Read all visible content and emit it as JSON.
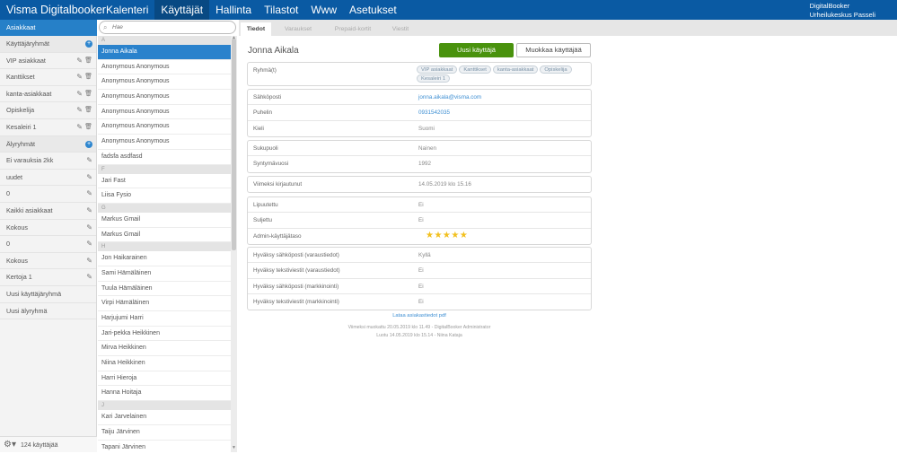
{
  "topbar": {
    "brand": "Visma Digitalbooker",
    "nav": [
      "Kalenteri",
      "Käyttäjät",
      "Hallinta",
      "Tilastot",
      "Www",
      "Asetukset"
    ],
    "account_line1": "DigitalBooker",
    "account_line2": "Urheilukeskus Passeli"
  },
  "sidebar": {
    "section_tab": "Asiakkaat",
    "rows": [
      {
        "label": "Käyttäjäryhmät",
        "type": "header"
      },
      {
        "label": "VIP asiakkaat",
        "type": "group"
      },
      {
        "label": "Kanttikset",
        "type": "group"
      },
      {
        "label": "kanta-asiakkaat",
        "type": "group"
      },
      {
        "label": "Opiskelija",
        "type": "group"
      },
      {
        "label": "Kesaleiri 1",
        "type": "group"
      },
      {
        "label": "Älyryhmät",
        "type": "header"
      },
      {
        "label": "Ei varauksia 2kk",
        "type": "smart"
      },
      {
        "label": "uudet",
        "type": "smart"
      },
      {
        "label": "0",
        "type": "smart"
      },
      {
        "label": "Kaikki asiakkaat",
        "type": "smart"
      },
      {
        "label": "Kokous",
        "type": "smart"
      },
      {
        "label": "0",
        "type": "smart"
      },
      {
        "label": "Kokous",
        "type": "smart"
      },
      {
        "label": "Kertoja 1",
        "type": "smart"
      },
      {
        "label": "Uusi käyttäjäryhmä",
        "type": "action"
      },
      {
        "label": "Uusi älyryhmä",
        "type": "action"
      }
    ],
    "footer_count": "124 käyttäjää"
  },
  "search": {
    "placeholder": "Hae"
  },
  "user_list": [
    {
      "group": "A",
      "users": [
        "Jonna Aikala",
        "Anonymous Anonymous",
        "Anonymous Anonymous",
        "Anonymous Anonymous",
        "Anonymous Anonymous",
        "Anonymous Anonymous",
        "Anonymous Anonymous",
        "fadsfa asdfasd"
      ]
    },
    {
      "group": "F",
      "users": [
        "Jari Fast",
        "Liisa Fysio"
      ]
    },
    {
      "group": "G",
      "users": [
        "Markus Gmail",
        "Markus Gmail"
      ]
    },
    {
      "group": "H",
      "users": [
        "Jon Haikarainen",
        "Sami Hämäläinen",
        "Tuula Hämäläinen",
        "Virpi Hämäläinen",
        "Harjujumi Harri",
        "Jari-pekka Heikkinen",
        "Mirva Heikkinen",
        "Niina Heikkinen",
        "Harri Hieroja",
        "Hanna Hoitaja"
      ]
    },
    {
      "group": "J",
      "users": [
        "Kari Jarvelainen",
        "Taiju Järvinen",
        "Tapani Järvinen"
      ]
    }
  ],
  "selected_user": "Jonna Aikala",
  "tabs": [
    "Tiedot",
    "Varaukset",
    "Prepaid-kortit",
    "Viestit"
  ],
  "detail": {
    "name": "Jonna Aikala",
    "new_user_button": "Uusi käyttäjä",
    "edit_user_button": "Muokkaa käyttäjää",
    "groups_label": "Ryhmä(t)",
    "groups": [
      "VIP asiakkaat",
      "Kanttikset",
      "kanta-asiakkaat",
      "Opiskelija",
      "Kesaleiri 1"
    ],
    "contact": [
      {
        "label": "Sähköposti",
        "value": "jonna.aikala@visma.com",
        "link": true
      },
      {
        "label": "Puhelin",
        "value": "0931542035",
        "link": true
      },
      {
        "label": "Kieli",
        "value": "Suomi",
        "link": false
      }
    ],
    "personal": [
      {
        "label": "Sukupuoli",
        "value": "Nainen"
      },
      {
        "label": "Syntymävuosi",
        "value": "1992"
      }
    ],
    "login": [
      {
        "label": "Viimeksi kirjautunut",
        "value": "14.05.2019 klo 15.16"
      }
    ],
    "status": [
      {
        "label": "Lipuutettu",
        "value": "Ei"
      },
      {
        "label": "Suljettu",
        "value": "Ei"
      },
      {
        "label": "Admin-käyttäjätaso",
        "stars": "★★★★★",
        "rating": 5
      }
    ],
    "consents": [
      {
        "label": "Hyväksy sähköposti (varaustiedot)",
        "value": "Kyllä"
      },
      {
        "label": "Hyväksy tekstiviestit (varaustiedot)",
        "value": "Ei"
      },
      {
        "label": "Hyväksy sähköposti (markkinointi)",
        "value": "Ei"
      },
      {
        "label": "Hyväksy tekstiviestit (markkinointi)",
        "value": "Ei"
      }
    ],
    "pdf_link": "Lataa asiakastiedot pdf",
    "modified_line": "Viimeksi muokattu 20.05.2019 klo 11.49 - DigitalBooker Administrator",
    "created_line": "Luotu 14.05.2019 klo 15.14 - Niina Kataja"
  },
  "colors": {
    "topbar": "#0a5aa3",
    "accent": "#2a82cc",
    "primary_button": "#49920d",
    "link": "#3e8fd3",
    "star": "#f2c01e"
  }
}
